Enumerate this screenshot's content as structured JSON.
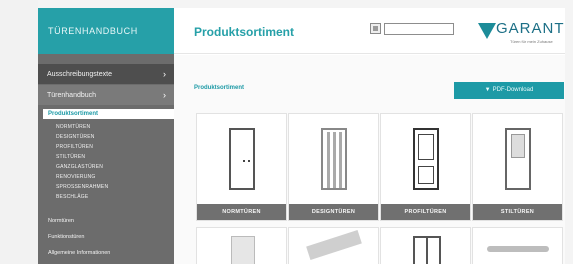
{
  "brand": {
    "title": "TÜRENHANDBUCH"
  },
  "header": {
    "page_title": "Produktsortiment",
    "search": {
      "value": "",
      "placeholder": ""
    },
    "logo": {
      "text": "GARANT",
      "tagline": "Türen für mein Zuhause"
    }
  },
  "sidebar": {
    "sections": [
      {
        "label": "Ausschreibungstexte",
        "chevron": "›"
      },
      {
        "label": "Türenhandbuch",
        "chevron": "›"
      }
    ],
    "active_item": "Produktsortiment",
    "sub_items": [
      "NORMTÜREN",
      "DESIGNTÜREN",
      "PROFILTÜREN",
      "STILTÜREN",
      "GANZGLASTÜREN",
      "RENOVIERUNG",
      "SPROSSENRAHMEN",
      "BESCHLÄGE"
    ],
    "main_items": [
      "Normtüren",
      "Funktionstüren",
      "Allgemeine Informationen"
    ]
  },
  "content": {
    "breadcrumb": "Produktsortiment",
    "pdf_button": "PDF-Download",
    "tiles": [
      {
        "label": "NORMTÜREN",
        "icon": "door-plain-icon"
      },
      {
        "label": "DESIGNTÜREN",
        "icon": "door-design-icon"
      },
      {
        "label": "PROFILTÜREN",
        "icon": "door-profile-icon"
      },
      {
        "label": "STILTÜREN",
        "icon": "door-stile-icon"
      }
    ]
  }
}
